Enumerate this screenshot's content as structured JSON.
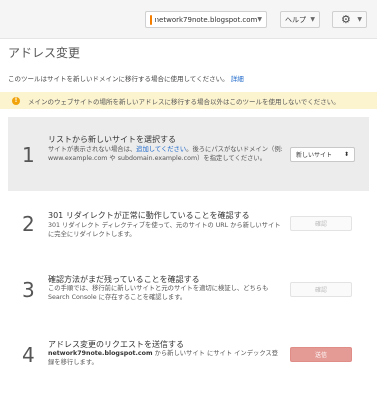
{
  "topbar": {
    "site_name": "network79note.blogspot.com",
    "help_label": "ヘルプ",
    "gear_glyph": "⚙"
  },
  "page": {
    "title": "アドレス変更",
    "intro_text": "このツールはサイトを新しいドメインに移行する場合に使用してください。",
    "intro_link": "詳細"
  },
  "warning": {
    "text": "メインのウェブサイトの場所を新しいアドレスに移行する場合以外はこのツールを使用しないでください。"
  },
  "steps": [
    {
      "number": "1",
      "title": "リストから新しいサイトを選択する",
      "desc_before": "サイトが表示されない場合は、",
      "desc_link": "追加してください",
      "desc_after": "。後ろにパスがないドメイン（例: www.example.com や subdomain.example.com）を指定してください。",
      "control_label": "新しいサイト"
    },
    {
      "number": "2",
      "title": "301 リダイレクトが正常に動作していることを確認する",
      "desc": "301 リダイレクト ディレクティブを使って、元のサイトの URL から新しいサイトに完全にリダイレクトします。",
      "button_label": "確認"
    },
    {
      "number": "3",
      "title": "確認方法がまだ残っていることを確認する",
      "desc": "この手順では、移行前に新しいサイトと元のサイトを適切に検証し、どちらも Search Console に存在することを確認します。",
      "button_label": "確認"
    },
    {
      "number": "4",
      "title": "アドレス変更のリクエストを送信する",
      "desc_bold": "network79note.blogspot.com",
      "desc_after": " から新しいサイト にサイト インデックス登録を移行します。",
      "button_label": "送信"
    }
  ],
  "colors": {
    "link": "#1a66c9",
    "warning_bg": "#fcf3cf",
    "warning_icon": "#f0a30a",
    "submit": "#e49a95"
  }
}
